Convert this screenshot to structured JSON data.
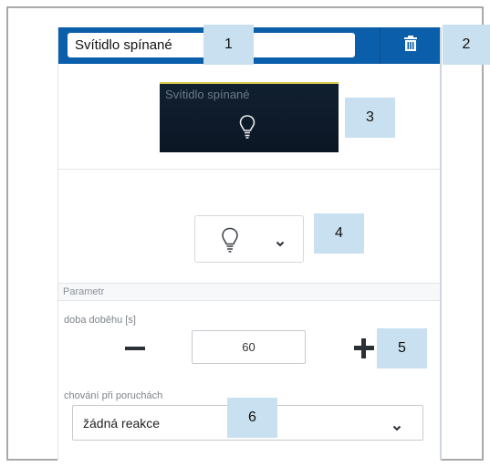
{
  "header": {
    "name_value": "Svítidlo spínané",
    "trash_icon": "trash-icon",
    "accent_color": "#0a5eaa"
  },
  "preview": {
    "title": "Svítidlo spínané",
    "icon": "lightbulb-icon",
    "background": "#0b1624"
  },
  "icon_picker": {
    "selected_icon": "lightbulb-icon",
    "dropdown_icon": "chevron-down-icon"
  },
  "parameters": {
    "section_title": "Parametr",
    "run_time": {
      "label": "doba doběhu [s]",
      "value": "60",
      "decrement_icon": "minus-icon",
      "increment_icon": "plus-icon"
    },
    "fault_behavior": {
      "label": "chování při poruchách",
      "selected": "žádná reakce",
      "dropdown_icon": "chevron-down-icon"
    }
  },
  "callouts": [
    "1",
    "2",
    "3",
    "4",
    "5",
    "6"
  ]
}
